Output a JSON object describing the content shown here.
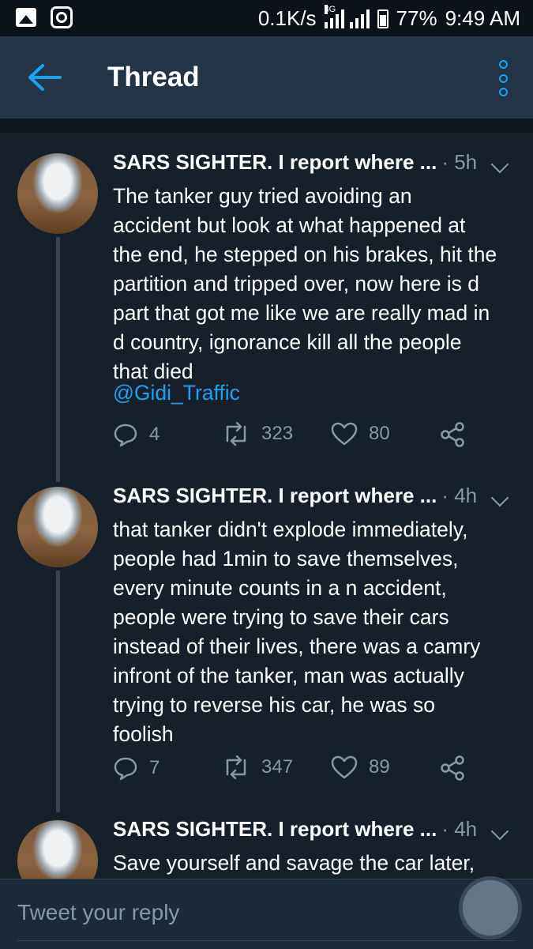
{
  "status_bar": {
    "speed": "0.1K/s",
    "network": "3G",
    "battery": "77%",
    "time": "9:49 AM"
  },
  "header": {
    "title": "Thread"
  },
  "tweets": [
    {
      "name": "SARS SIGHTER. I report where ...",
      "time": "· 5h",
      "text": "The tanker guy tried avoiding an\naccident but look at what happened at\nthe end, he stepped on his brakes, hit the\npartition and tripped over, now here is d\npart that got me like we are really mad in\nd country, ignorance kill all the people\nthat died",
      "mention": "@Gidi_Traffic",
      "replies": "4",
      "retweets": "323",
      "likes": "80"
    },
    {
      "name": "SARS SIGHTER. I report where ...",
      "time": "· 4h",
      "text": "that tanker didn't explode immediately,\npeople had 1min to save themselves,\nevery minute counts in a n accident,\npeople were trying to save their cars\ninstead of their lives,  there was a camry\ninfront of the tanker,  man was actually\ntrying to reverse his car, he was so\nfoolish",
      "replies": "7",
      "retweets": "347",
      "likes": "89"
    },
    {
      "name": "SARS SIGHTER. I report where ...",
      "time": "· 4h",
      "text": "Save yourself and savage the car later,"
    }
  ],
  "reply_bar": {
    "placeholder": "Tweet your reply"
  },
  "colors": {
    "background": "#15202b",
    "header": "#243447",
    "accent": "#1da1f2",
    "muted": "#8899a6"
  }
}
